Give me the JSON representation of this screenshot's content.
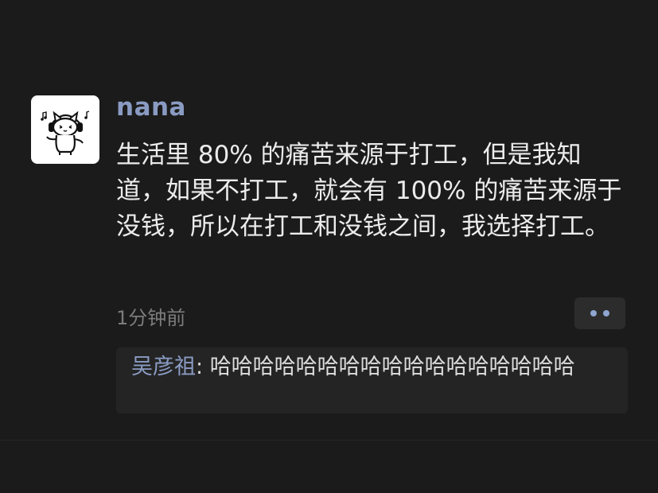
{
  "post": {
    "username": "nana",
    "avatar_icon": "cat-with-headphones-icon",
    "content": "生活里 80% 的痛苦来源于打工，但是我知道，如果不打工，就会有 100% 的痛苦来源于没钱，所以在打工和没钱之间，我选择打工。",
    "timestamp": "1分钟前",
    "more_icon": "more-dots-icon"
  },
  "comments": [
    {
      "author": "吴彦祖",
      "separator": ": ",
      "text": "哈哈哈哈哈哈哈哈哈哈哈哈哈哈哈哈哈"
    }
  ],
  "colors": {
    "background": "#1b1b1b",
    "username": "#8a9bc3",
    "text": "#ececec",
    "muted": "#7c7c7c",
    "comment_bg": "#242424",
    "accent_dots": "#8ea6cf"
  }
}
